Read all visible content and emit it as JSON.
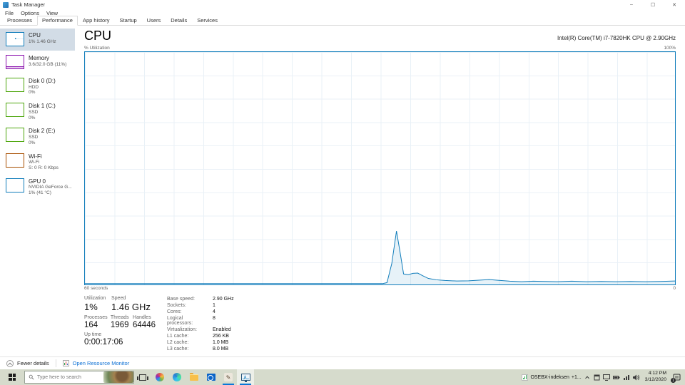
{
  "window": {
    "title": "Task Manager",
    "menus": [
      "File",
      "Options",
      "View"
    ],
    "controls": {
      "minimize": "–",
      "maximize": "☐",
      "close": "✕"
    }
  },
  "tabs": [
    {
      "label": "Processes",
      "active": false
    },
    {
      "label": "Performance",
      "active": true
    },
    {
      "label": "App history",
      "active": false
    },
    {
      "label": "Startup",
      "active": false
    },
    {
      "label": "Users",
      "active": false
    },
    {
      "label": "Details",
      "active": false
    },
    {
      "label": "Services",
      "active": false
    }
  ],
  "sidebar": {
    "items": [
      {
        "key": "cpu",
        "title": "CPU",
        "line2": "1% 1.46 GHz",
        "line3": "",
        "color": "#117dbb",
        "selected": true
      },
      {
        "key": "memory",
        "title": "Memory",
        "line2": "3.6/32.0 GB (11%)",
        "line3": "",
        "color": "#8b12ae",
        "selected": false
      },
      {
        "key": "disk0",
        "title": "Disk 0 (D:)",
        "line2": "HDD",
        "line3": "0%",
        "color": "#4da60c",
        "selected": false
      },
      {
        "key": "disk1",
        "title": "Disk 1 (C:)",
        "line2": "SSD",
        "line3": "0%",
        "color": "#4da60c",
        "selected": false
      },
      {
        "key": "disk2",
        "title": "Disk 2 (E:)",
        "line2": "SSD",
        "line3": "0%",
        "color": "#4da60c",
        "selected": false
      },
      {
        "key": "wifi",
        "title": "Wi-Fi",
        "line2": "Wi-Fi",
        "line3": "S: 0 R: 0 Kbps",
        "color": "#a74f01",
        "selected": false
      },
      {
        "key": "gpu",
        "title": "GPU 0",
        "line2": "NVIDIA GeForce G...",
        "line3": "1% (41 °C)",
        "color": "#117dbb",
        "selected": false
      }
    ]
  },
  "main": {
    "title": "CPU",
    "subtitle": "Intel(R) Core(TM) i7-7820HK CPU @ 2.90GHz",
    "chart_labels": {
      "top_left": "% Utilization",
      "top_right": "100%",
      "bottom_left": "60 seconds",
      "bottom_right": "0"
    },
    "stats": {
      "utilization": {
        "label": "Utilization",
        "value": "1%"
      },
      "speed": {
        "label": "Speed",
        "value": "1.46 GHz"
      },
      "processes": {
        "label": "Processes",
        "value": "164"
      },
      "threads": {
        "label": "Threads",
        "value": "1969"
      },
      "handles": {
        "label": "Handles",
        "value": "64446"
      },
      "uptime": {
        "label": "Up time",
        "value": "0:00:17:06"
      }
    },
    "details": [
      {
        "label": "Base speed:",
        "value": "2.90 GHz"
      },
      {
        "label": "Sockets:",
        "value": "1"
      },
      {
        "label": "Cores:",
        "value": "4"
      },
      {
        "label": "Logical processors:",
        "value": "8"
      },
      {
        "label": "Virtualization:",
        "value": "Enabled"
      },
      {
        "label": "L1 cache:",
        "value": "256 KB"
      },
      {
        "label": "L2 cache:",
        "value": "1.0 MB"
      },
      {
        "label": "L3 cache:",
        "value": "8.0 MB"
      }
    ]
  },
  "footer": {
    "details_label": "Fewer details",
    "resource_link": "Open Resource Monitor"
  },
  "taskbar": {
    "search_placeholder": "Type here to search",
    "ticker_name": "OSEBX-indeksen",
    "ticker_change": "+1...",
    "time": "4:12 PM",
    "date": "3/12/2020",
    "notification_badge": "1"
  },
  "colors": {
    "accent_blue": "#117dbb",
    "memory_purple": "#8b12ae",
    "disk_green": "#4da60c",
    "wifi_brown": "#a74f01",
    "link_blue": "#0b6fd4",
    "taskbar_bg": "#d6dbcc",
    "selected_item_bg": "#d2dce6"
  },
  "chart_data": {
    "type": "area",
    "title": "CPU % Utilization over 60 seconds",
    "xlabel": "60 seconds (left) to 0 (right)",
    "ylabel": "% Utilization",
    "x_range": [
      60,
      0
    ],
    "ylim": [
      0,
      100
    ],
    "grid": true,
    "series": [
      {
        "name": "CPU utilization",
        "points_pct": [
          [
            0,
            0.4
          ],
          [
            10,
            0.4
          ],
          [
            20,
            0.4
          ],
          [
            30,
            0.4
          ],
          [
            40,
            0.4
          ],
          [
            48,
            0.4
          ],
          [
            50.5,
            0.4
          ],
          [
            51.2,
            0.8
          ],
          [
            52.0,
            9
          ],
          [
            52.8,
            23
          ],
          [
            53.4,
            14
          ],
          [
            54.0,
            4.5
          ],
          [
            54.8,
            4.2
          ],
          [
            55.6,
            4.8
          ],
          [
            56.4,
            4.9
          ],
          [
            57.2,
            3.8
          ],
          [
            58.2,
            2.6
          ],
          [
            59.5,
            2.0
          ],
          [
            61,
            1.7
          ],
          [
            63,
            1.5
          ],
          [
            65,
            1.6
          ],
          [
            67,
            1.9
          ],
          [
            68.5,
            2.1
          ],
          [
            70,
            1.8
          ],
          [
            72,
            1.4
          ],
          [
            74,
            1.2
          ],
          [
            76,
            1.4
          ],
          [
            78,
            1.3
          ],
          [
            80,
            1.2
          ],
          [
            82.5,
            1.4
          ],
          [
            85,
            1.2
          ],
          [
            87.5,
            1.3
          ],
          [
            90,
            1.2
          ],
          [
            92.5,
            1.3
          ],
          [
            95,
            1.2
          ],
          [
            97.5,
            1.3
          ],
          [
            100,
            1.5
          ]
        ]
      }
    ]
  }
}
